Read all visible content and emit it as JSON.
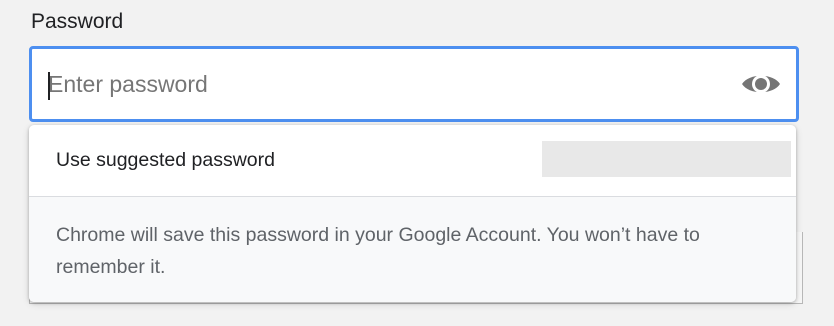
{
  "field": {
    "label": "Password",
    "placeholder": "Enter password",
    "value": ""
  },
  "visibility_toggle": {
    "icon": "eye-icon"
  },
  "popup": {
    "suggest_label": "Use suggested password",
    "suggested_value": "",
    "footer_text": "Chrome will save this password in your Google Account. You won’t have to remember it."
  },
  "colors": {
    "focus_border": "#4d8ff0",
    "icon": "#757575"
  }
}
